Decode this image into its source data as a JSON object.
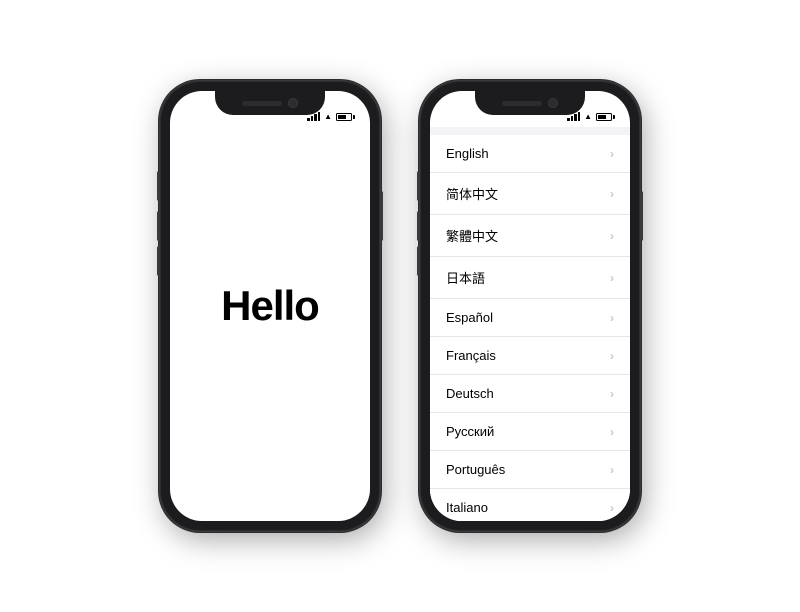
{
  "phone1": {
    "hello_text": "Hello",
    "status": {
      "signal_bars": [
        3,
        5,
        7,
        9,
        11
      ],
      "battery_level": "70%"
    }
  },
  "phone2": {
    "status": {
      "signal_bars": [
        3,
        5,
        7,
        9,
        11
      ],
      "battery_level": "70%"
    },
    "languages": [
      {
        "id": "english",
        "name": "English"
      },
      {
        "id": "simplified-chinese",
        "name": "简体中文"
      },
      {
        "id": "traditional-chinese",
        "name": "繁體中文"
      },
      {
        "id": "japanese",
        "name": "日本語"
      },
      {
        "id": "spanish",
        "name": "Español"
      },
      {
        "id": "french",
        "name": "Français"
      },
      {
        "id": "german",
        "name": "Deutsch"
      },
      {
        "id": "russian",
        "name": "Русский"
      },
      {
        "id": "portuguese",
        "name": "Português"
      },
      {
        "id": "italian",
        "name": "Italiano"
      }
    ]
  }
}
